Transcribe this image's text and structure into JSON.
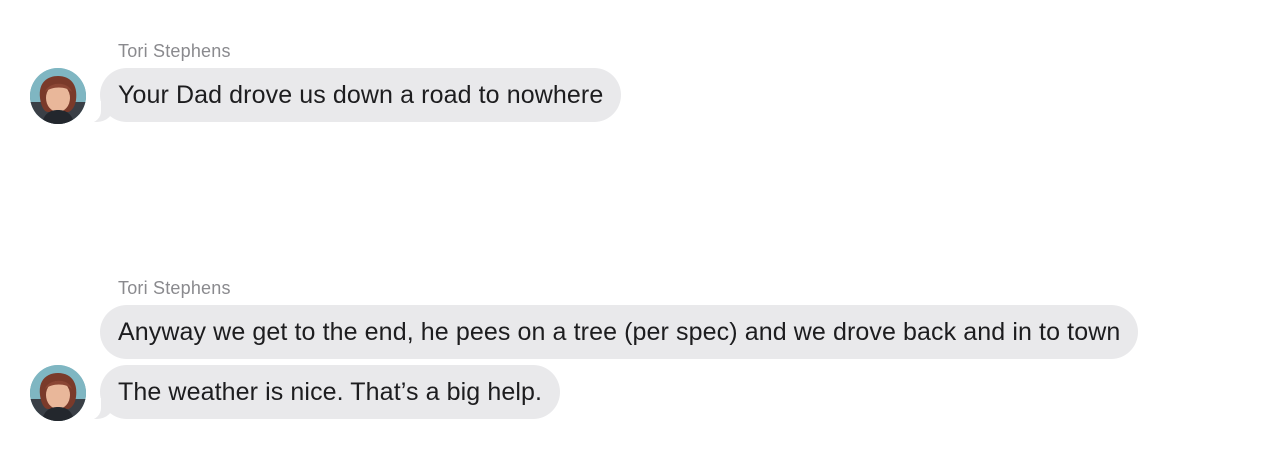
{
  "messages": [
    {
      "sender": "Tori Stephens",
      "text": "Your Dad drove us down a road to nowhere",
      "avatar_icon": "person-avatar-icon"
    },
    {
      "sender": "Tori Stephens",
      "text": "Anyway we get to the end, he pees on a tree (per spec) and we drove back and in to town"
    },
    {
      "text": "The weather is nice. That’s a big help.",
      "avatar_icon": "person-avatar-icon"
    }
  ],
  "colors": {
    "bubble": "#e9e9eb",
    "sender_text": "#8a8a8e",
    "message_text": "#1d1d1f",
    "background": "#ffffff"
  }
}
